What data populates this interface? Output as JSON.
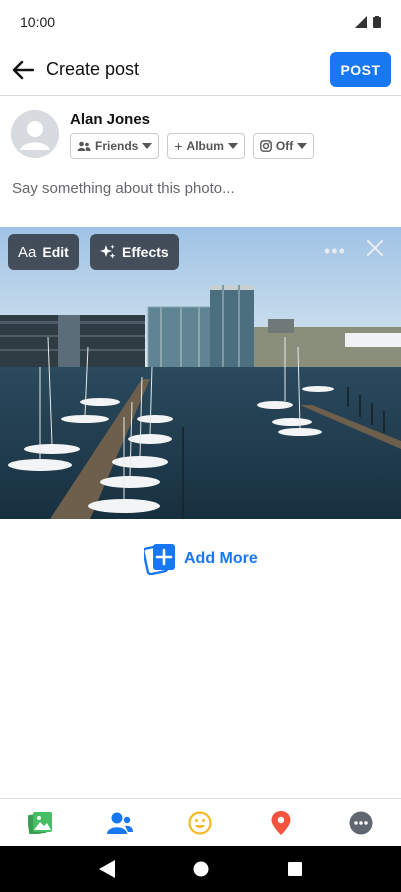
{
  "status_bar": {
    "time": "10:00"
  },
  "app_bar": {
    "title": "Create post",
    "post_label": "POST"
  },
  "user": {
    "name": "Alan Jones",
    "chips": [
      {
        "label": "Friends",
        "icon": "friends-icon"
      },
      {
        "label": "Album",
        "icon": "plus-icon"
      },
      {
        "label": "Off",
        "icon": "instagram-icon"
      }
    ]
  },
  "composer": {
    "placeholder": "Say something about this photo..."
  },
  "photo_overlay": {
    "edit_label": "Edit",
    "edit_icon_text": "Aa",
    "effects_label": "Effects"
  },
  "add_more_label": "Add More",
  "toolbar": [
    "photo-icon",
    "tag-people-icon",
    "feeling-icon",
    "location-icon",
    "more-icon"
  ],
  "colors": {
    "accent": "#1877f2",
    "toolbar_photo": "#45bd62",
    "feeling": "#f7b928",
    "location": "#f5533d"
  }
}
